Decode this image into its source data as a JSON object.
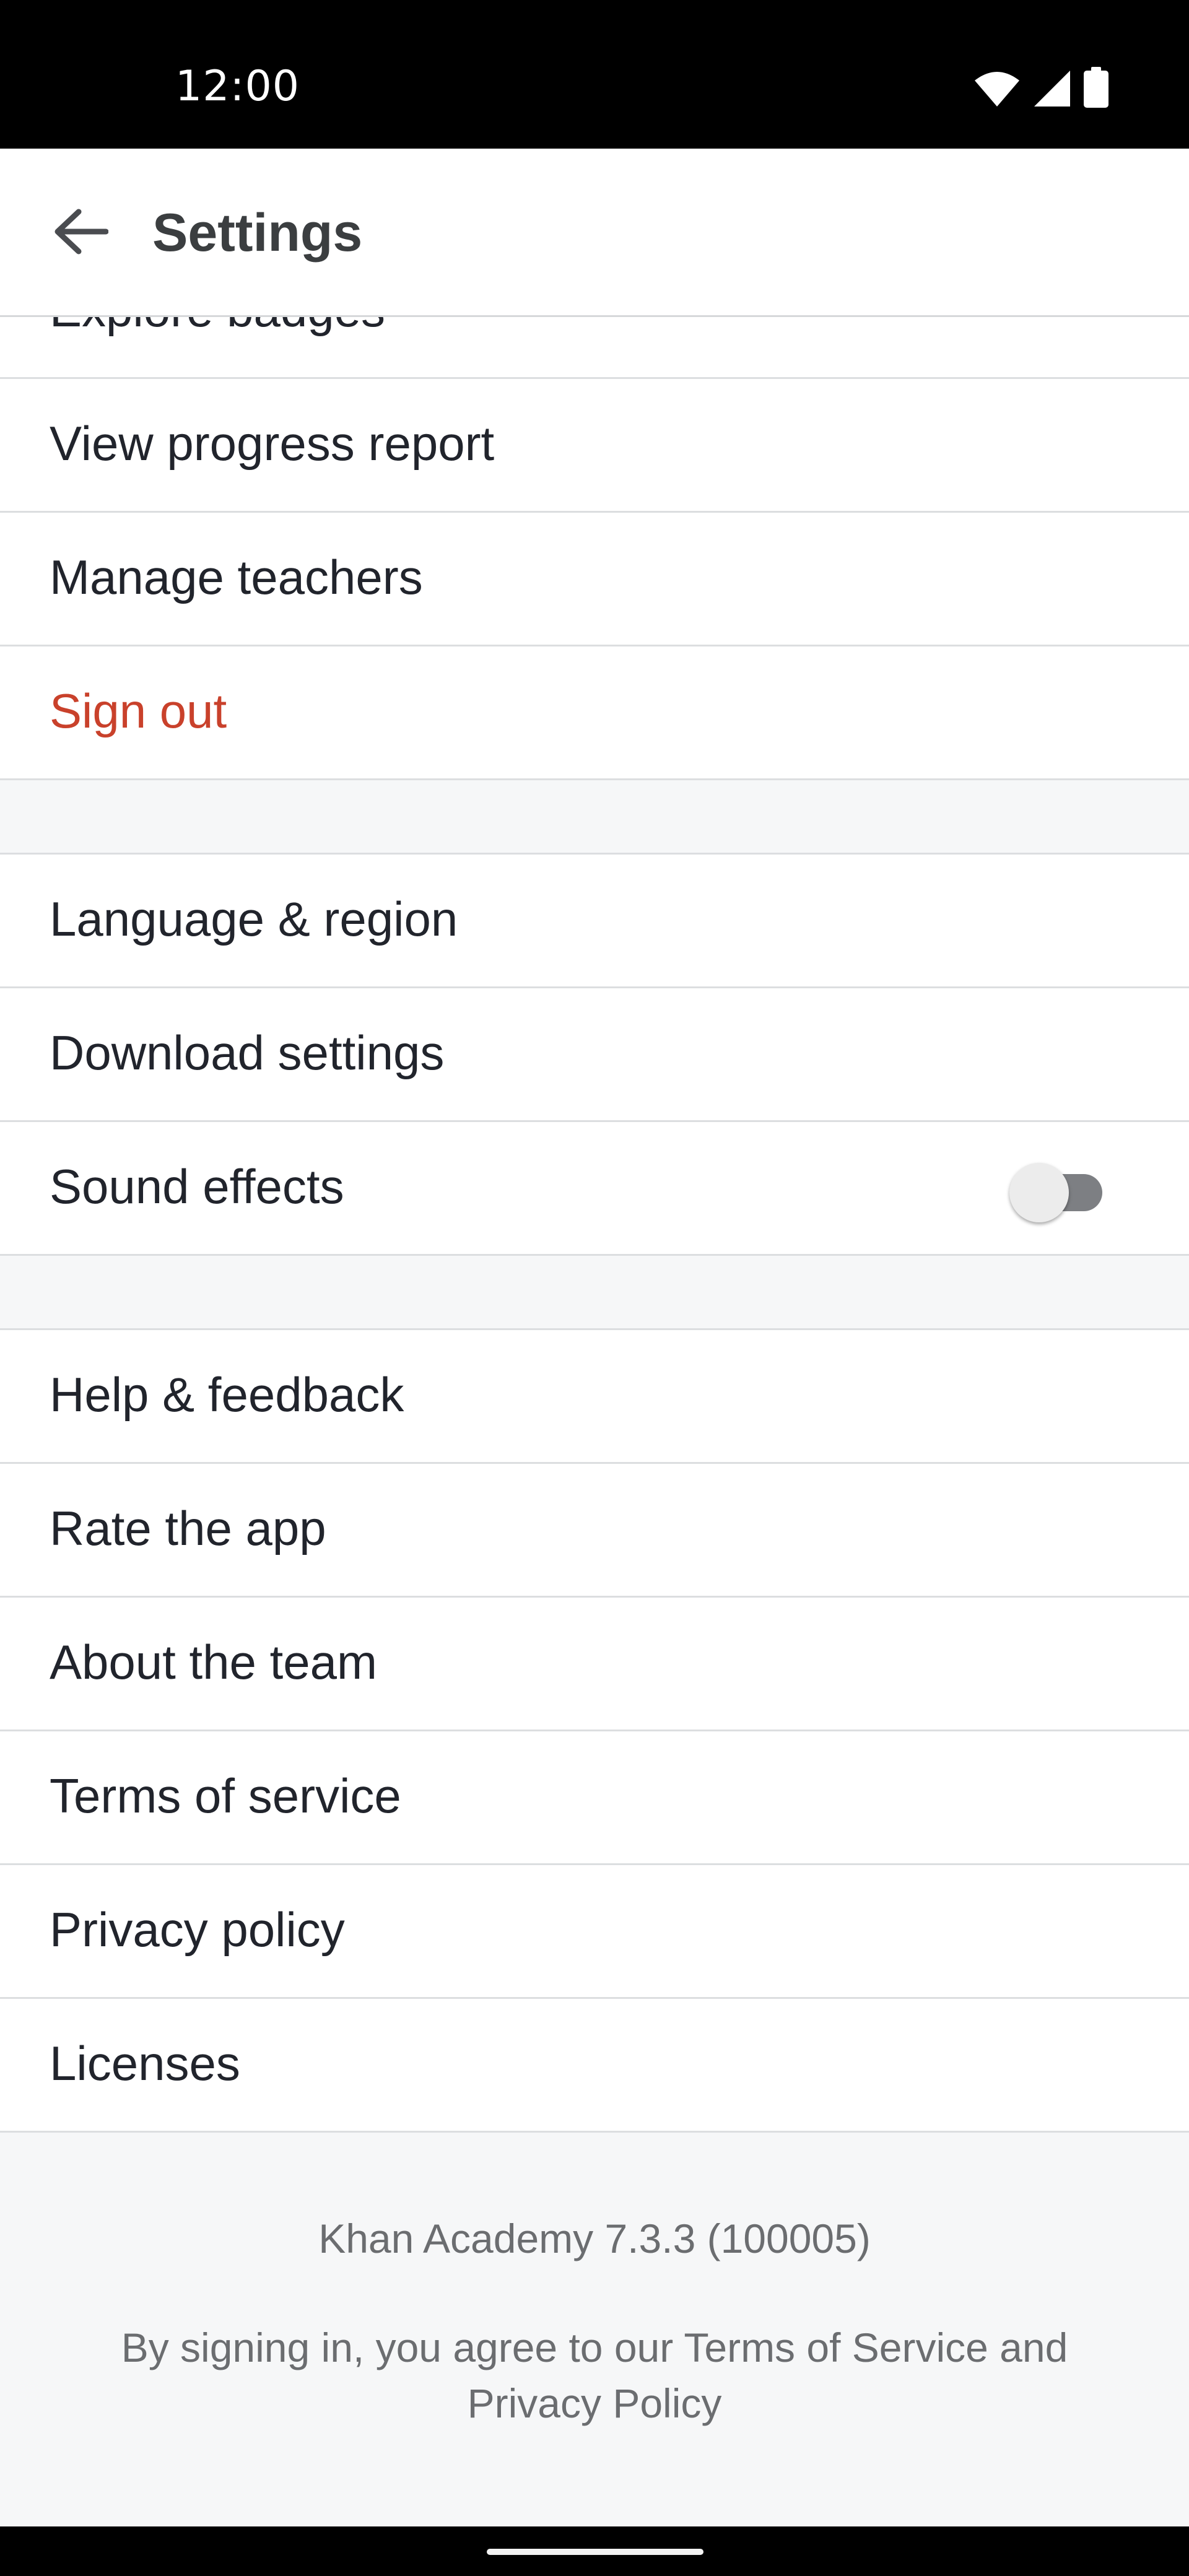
{
  "status_bar": {
    "time": "12:00",
    "icons": [
      "wifi-icon",
      "cellular-signal-icon",
      "battery-icon"
    ]
  },
  "app_bar": {
    "back_icon": "arrow-back-icon",
    "title": "Settings"
  },
  "sections": {
    "account": {
      "items": [
        {
          "label": "Explore badges"
        },
        {
          "label": "View progress report"
        },
        {
          "label": "Manage teachers"
        },
        {
          "label": "Sign out"
        }
      ]
    },
    "preferences": {
      "items": [
        {
          "label": "Language & region"
        },
        {
          "label": "Download settings"
        },
        {
          "label": "Sound effects",
          "toggle": false
        }
      ]
    },
    "about": {
      "items": [
        {
          "label": "Help & feedback"
        },
        {
          "label": "Rate the app"
        },
        {
          "label": "About the team"
        },
        {
          "label": "Terms of service"
        },
        {
          "label": "Privacy policy"
        },
        {
          "label": "Licenses"
        }
      ]
    }
  },
  "footer": {
    "version": "Khan Academy 7.3.3 (100005)",
    "terms": "By signing in, you agree to our Terms of Service and Privacy Policy"
  },
  "colors": {
    "danger": "#c9412b",
    "text": "#21242c",
    "background": "#f6f7f8"
  }
}
